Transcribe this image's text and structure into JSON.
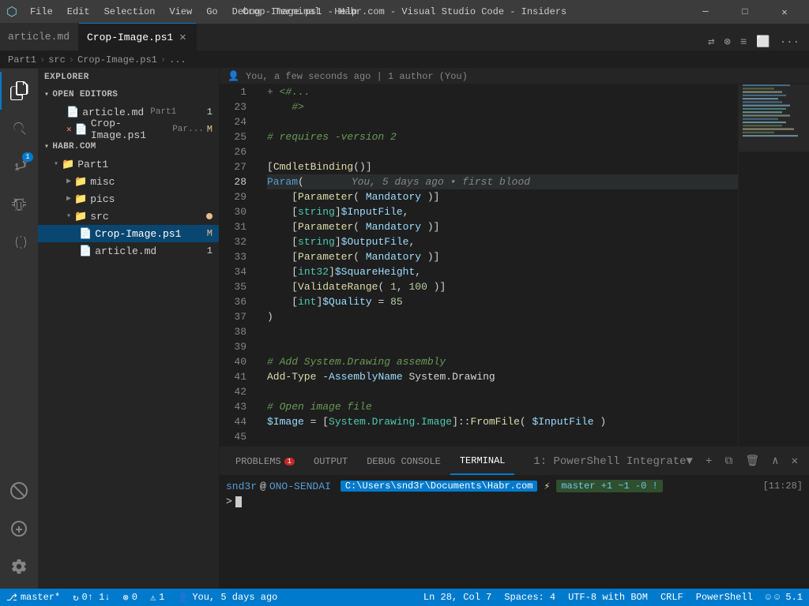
{
  "titlebar": {
    "logo": "⬡",
    "menu_items": [
      "File",
      "Edit",
      "Selection",
      "View",
      "Go",
      "Debug",
      "Terminal",
      "Help"
    ],
    "title": "Crop-Image.ps1 - Habr.com - Visual Studio Code - Insiders",
    "btn_minimize": "─",
    "btn_maximize": "□",
    "btn_close": "✕"
  },
  "tabs": {
    "inactive_tab_label": "article.md",
    "active_tab_label": "Crop-Image.ps1",
    "close_icon": "✕"
  },
  "breadcrumb": {
    "parts": [
      "Part1",
      "src",
      "Crop-Image.ps1",
      "..."
    ]
  },
  "git_blame": {
    "text": "You, a few seconds ago  |  1 author (You)"
  },
  "sidebar": {
    "title": "EXPLORER",
    "open_editors_header": "OPEN EDITORS",
    "open_editors": [
      {
        "label": "article.md",
        "section": "Part1",
        "badge": "1",
        "modified": false
      },
      {
        "label": "Crop-Image.ps1",
        "prefix": "✕",
        "section": "Par...",
        "badge": "M",
        "modified": true
      }
    ],
    "habr_section": "HABR.COM",
    "tree": [
      {
        "label": "Part1",
        "type": "folder",
        "open": true,
        "indent": 0
      },
      {
        "label": "misc",
        "type": "folder",
        "open": false,
        "indent": 1
      },
      {
        "label": "pics",
        "type": "folder",
        "open": false,
        "indent": 1
      },
      {
        "label": "src",
        "type": "folder",
        "open": true,
        "indent": 1
      },
      {
        "label": "Crop-Image.ps1",
        "type": "file",
        "indent": 2,
        "badge": "M",
        "active": true
      },
      {
        "label": "article.md",
        "type": "file",
        "indent": 2,
        "badge": "1"
      }
    ]
  },
  "editor": {
    "lines": [
      {
        "num": 1,
        "content": ""
      },
      {
        "num": 23,
        "content": ""
      },
      {
        "num": 24,
        "content": ""
      },
      {
        "num": 25,
        "content": "# requires -version 2"
      },
      {
        "num": 26,
        "content": ""
      },
      {
        "num": 27,
        "content": "[CmdletBinding()]"
      },
      {
        "num": 28,
        "content": "Param(",
        "active": true,
        "blame": "You, 5 days ago • first blood"
      },
      {
        "num": 29,
        "content": "    [Parameter( Mandatory )]"
      },
      {
        "num": 30,
        "content": "    [string]$InputFile,"
      },
      {
        "num": 31,
        "content": "    [Parameter( Mandatory )]"
      },
      {
        "num": 32,
        "content": "    [string]$OutputFile,"
      },
      {
        "num": 33,
        "content": "    [Parameter( Mandatory )]"
      },
      {
        "num": 34,
        "content": "    [int32]$SquareHeight,"
      },
      {
        "num": 35,
        "content": "    [ValidateRange( 1, 100 )]"
      },
      {
        "num": 36,
        "content": "    [int]$Quality = 85"
      },
      {
        "num": 37,
        "content": ")"
      },
      {
        "num": 38,
        "content": ""
      },
      {
        "num": 39,
        "content": ""
      },
      {
        "num": 40,
        "content": "# Add System.Drawing assembly"
      },
      {
        "num": 41,
        "content": "Add-Type -AssemblyName System.Drawing"
      },
      {
        "num": 42,
        "content": ""
      },
      {
        "num": 43,
        "content": "# Open image file"
      },
      {
        "num": 44,
        "content": "$Image = [System.Drawing.Image]::FromFile( $InputFile )"
      },
      {
        "num": 45,
        "content": ""
      }
    ]
  },
  "panel": {
    "tabs": [
      "PROBLEMS",
      "OUTPUT",
      "DEBUG CONSOLE",
      "TERMINAL"
    ],
    "active_tab": "TERMINAL",
    "problems_badge": "1",
    "terminal_title": "1: PowerShell Integrate▼",
    "prompt_user": "snd3r",
    "prompt_at": "@",
    "prompt_host": "ONO-SENDAI",
    "prompt_path": "C:\\Users\\snd3r\\Documents\\Habr.com",
    "prompt_arrow": "⚡",
    "prompt_git": "master +1 ~1 -0 !",
    "prompt_time": "[11:28]",
    "cursor_symbol": ">"
  },
  "statusbar": {
    "branch": "master*",
    "sync": "↻ 0↑ 1↓",
    "errors": "⊗ 0",
    "warnings": "⚠ 1",
    "blame": "You, 5 days ago",
    "position": "Ln 28, Col 7",
    "spaces": "Spaces: 4",
    "encoding": "UTF-8 with BOM",
    "line_ending": "CRLF",
    "language": "PowerShell",
    "feedback": "☺ 5.1"
  },
  "activity": {
    "items": [
      "📄",
      "🔍",
      "⎇",
      "🐛",
      "⬡"
    ],
    "bottom_items": [
      "⊘",
      "⟳",
      "⚙"
    ]
  }
}
